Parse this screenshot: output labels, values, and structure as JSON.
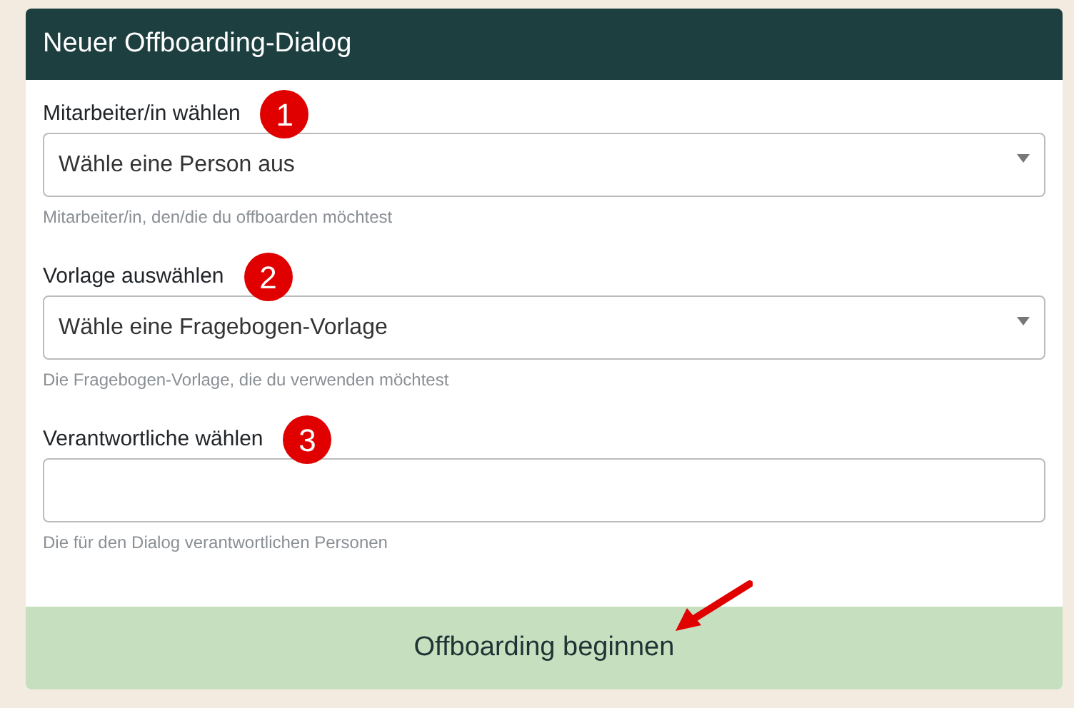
{
  "dialog": {
    "title": "Neuer Offboarding-Dialog"
  },
  "fields": [
    {
      "kind": "select",
      "label": "Mitarbeiter/in wählen",
      "marker": "1",
      "value": "Wähle eine Person aus",
      "hint": "Mitarbeiter/in, den/die du offboarden möchtest"
    },
    {
      "kind": "select",
      "label": "Vorlage auswählen",
      "marker": "2",
      "value": "Wähle eine Fragebogen-Vorlage",
      "hint": "Die Fragebogen-Vorlage, die du verwenden möchtest"
    },
    {
      "kind": "text",
      "label": "Verantwortliche wählen",
      "marker": "3",
      "hint": "Die für den Dialog verantwortlichen Personen"
    }
  ],
  "submit_button": {
    "label": "Offboarding beginnen"
  }
}
